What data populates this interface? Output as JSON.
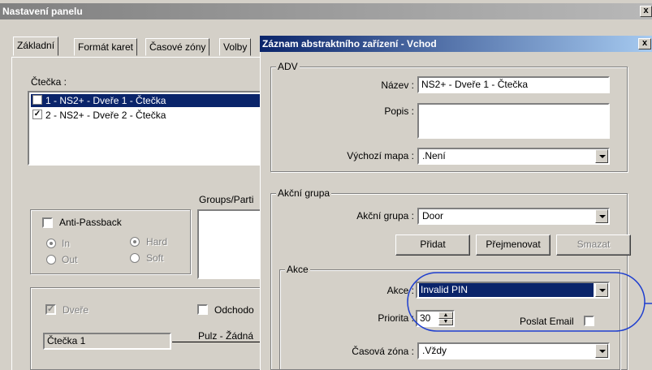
{
  "bg_window": {
    "title": "Nastavení panelu",
    "close": "x",
    "tabs": [
      "Základní",
      "Formát karet",
      "Časové zóny",
      "Volby"
    ],
    "reader_label": "Čtečka :",
    "readers": [
      {
        "label": "1 - NS2+ - Dveře 1 - Čtečka",
        "checked": true,
        "selected": true
      },
      {
        "label": "2 - NS2+ - Dveře 2 - Čtečka",
        "checked": true,
        "selected": false
      }
    ],
    "groups_label": "Groups/Parti",
    "anti_passback": {
      "label": "Anti-Passback",
      "in": "In",
      "out": "Out",
      "hard": "Hard",
      "soft": "Soft"
    },
    "door_label": "Dveře",
    "door_checked": true,
    "exit_label": "Odchodo",
    "reader_name": "Čtečka 1",
    "pulse_label": "Pulz - Žádná"
  },
  "dialog": {
    "title": "Záznam abstraktního zařízení - Vchod",
    "close": "x",
    "adv": {
      "legend": "ADV",
      "name_label": "Název :",
      "name_value": "NS2+ - Dveře 1 - Čtečka",
      "desc_label": "Popis :",
      "desc_value": "",
      "map_label": "Výchozí mapa :",
      "map_value": ".Není"
    },
    "action_group": {
      "legend": "Akční grupa",
      "group_label": "Akční grupa :",
      "group_value": "Door",
      "add_button": "Přidat",
      "rename_button": "Přejmenovat",
      "delete_button": "Smazat"
    },
    "action": {
      "legend": "Akce",
      "action_label": "Akce :",
      "action_value": "Invalid PIN",
      "priority_label": "Priorita :",
      "priority_value": "30",
      "email_label": "Poslat Email",
      "email_checked": false,
      "timezone_label": "Časová zóna :",
      "timezone_value": ".Vždy"
    }
  },
  "colors": {
    "face": "#d4d0c8",
    "selection": "#0a246a",
    "highlight_ellipse": "#1f3fcf"
  }
}
